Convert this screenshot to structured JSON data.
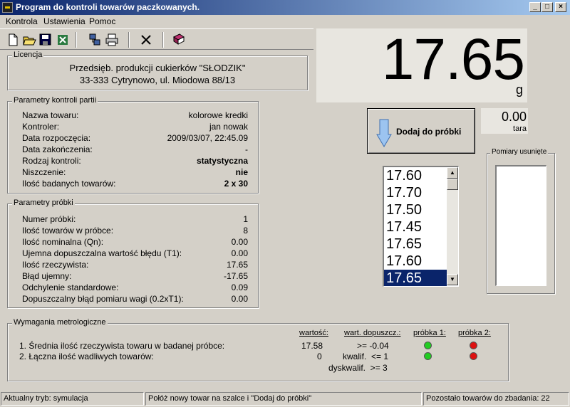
{
  "window": {
    "title": "Program do kontroli towarów paczkowanych.",
    "controls": {
      "minimize": "_",
      "maximize": "□",
      "close": "×"
    }
  },
  "menu": {
    "items": [
      "Kontrola",
      "Ustawienia",
      "Pomoc"
    ]
  },
  "toolbar": {
    "icons": [
      "new-file-icon",
      "open-folder-icon",
      "save-icon",
      "excel-icon",
      "network-icon",
      "print-icon",
      "delete-icon",
      "book-icon"
    ]
  },
  "license": {
    "title": "Licencja",
    "line1": "Przedsięb. produkcji cukierków \"SŁODZIK\"",
    "line2": "33-333 Cytrynowo, ul. Miodowa 88/13"
  },
  "batch": {
    "title": "Parametry kontroli partii",
    "rows": [
      {
        "label": "Nazwa towaru:",
        "value": "kolorowe kredki"
      },
      {
        "label": "Kontroler:",
        "value": "jan nowak"
      },
      {
        "label": "Data rozpoczęcia:",
        "value": "2009/03/07, 22:45.09"
      },
      {
        "label": "Data zakończenia:",
        "value": "-"
      },
      {
        "label": "Rodzaj kontroli:",
        "value": "statystyczna"
      },
      {
        "label": "Niszczenie:",
        "value": "nie"
      },
      {
        "label": "Ilość badanych towarów:",
        "value": "2 x 30"
      }
    ]
  },
  "sample": {
    "title": "Parametry próbki",
    "rows": [
      {
        "label": "Numer próbki:",
        "value": "1"
      },
      {
        "label": "Ilość towarów w próbce:",
        "value": "8"
      },
      {
        "label": "Ilość nominalna (Qn):",
        "value": "0.00"
      },
      {
        "label": "Ujemna dopuszczalna wartość błędu (T1):",
        "value": "0.00"
      },
      {
        "label": "Ilość rzeczywista:",
        "value": "17.65"
      },
      {
        "label": "Błąd ujemny:",
        "value": "-17.65"
      },
      {
        "label": "Odchylenie standardowe:",
        "value": "0.09"
      },
      {
        "label": "Dopuszczalny błąd pomiaru wagi (0.2xT1):",
        "value": "0.00"
      }
    ]
  },
  "metrology": {
    "title": "Wymagania metrologiczne",
    "headers": {
      "value": "wartość:",
      "allowed": "wart. dopuszcz.:",
      "sample1": "próbka 1:",
      "sample2": "próbka 2:"
    },
    "row1": {
      "label": "1. Średnia ilość rzeczywista towaru w badanej próbce:",
      "value": "17.58",
      "allowed": ">= -0.04",
      "s1": "green",
      "s2": "red"
    },
    "row2": {
      "label": "2. Łączna ilość wadliwych towarów:",
      "value": "0",
      "allowed": "kwalif.  <= 1",
      "allowed2": "dyskwalif.  >= 3",
      "s1": "green",
      "s2": "red"
    }
  },
  "scale": {
    "weight": "17.65",
    "unit": "g",
    "tare_value": "0.00",
    "tare_label": "tara",
    "add_button": "Dodaj do próbki"
  },
  "measurements": [
    "17.60",
    "17.70",
    "17.50",
    "17.45",
    "17.65",
    "17.60",
    "17.65"
  ],
  "selected_measurement": "17.65",
  "removed": {
    "title": "Pomiary usunięte"
  },
  "status": {
    "mode": "Aktualny tryb: symulacja",
    "hint": "Połóż nowy towar na szalce i \"Dodaj do próbki\"",
    "remaining": "Pozostało towarów do zbadania: 22"
  }
}
